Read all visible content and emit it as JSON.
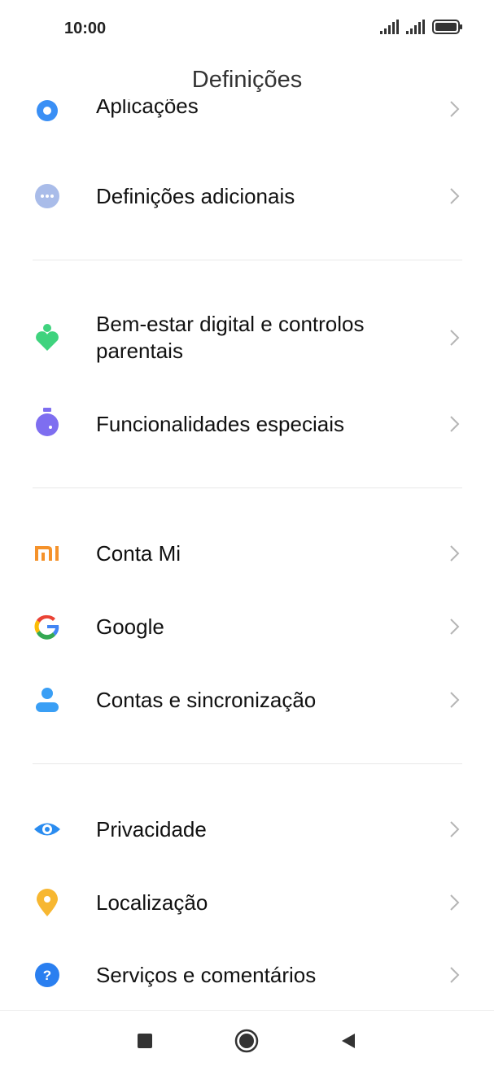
{
  "status_bar": {
    "time": "10:00",
    "icons": [
      "signal-icon",
      "signal-icon",
      "battery-icon"
    ]
  },
  "header": {
    "title": "Definições"
  },
  "settings": {
    "items": [
      {
        "label": "Aplicações",
        "icon": "gear-icon",
        "color": "#3a8ff5"
      },
      {
        "label": "Definições adicionais",
        "icon": "more-dots-icon",
        "color": "#9fb4e8"
      },
      {
        "label": "Bem-estar digital e controlos parentais",
        "icon": "heart-person-icon",
        "color": "#3fd37e"
      },
      {
        "label": "Funcionalidades especiais",
        "icon": "flask-icon",
        "color": "#7e6ef0"
      },
      {
        "label": "Conta Mi",
        "icon": "mi-logo-icon",
        "color": "#f5922b"
      },
      {
        "label": "Google",
        "icon": "google-g-icon",
        "color": "#4285f4"
      },
      {
        "label": "Contas e sincronização",
        "icon": "person-icon",
        "color": "#3a9ff5"
      },
      {
        "label": "Privacidade",
        "icon": "eye-icon",
        "color": "#2a8cf0"
      },
      {
        "label": "Localização",
        "icon": "location-pin-icon",
        "color": "#f7b731"
      },
      {
        "label": "Serviços e comentários",
        "icon": "help-circle-icon",
        "color": "#2a7ff0"
      }
    ]
  },
  "nav_bar": {
    "buttons": [
      "recents-square-icon",
      "home-circle-icon",
      "back-triangle-icon"
    ]
  }
}
